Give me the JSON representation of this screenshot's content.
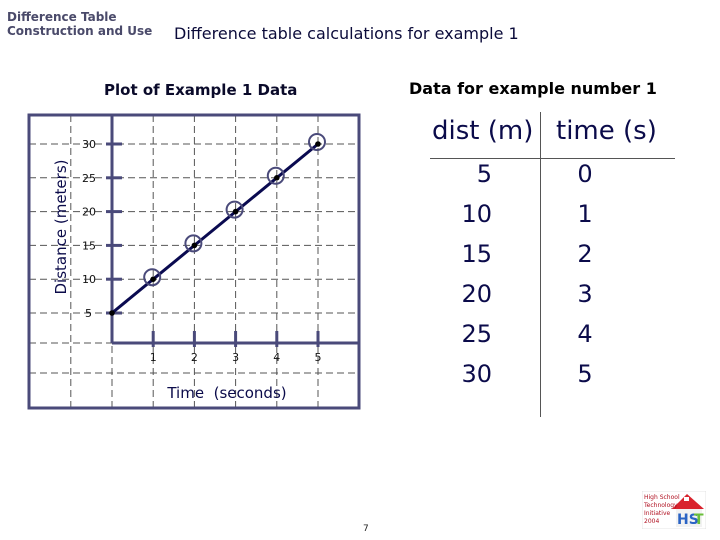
{
  "course_title": [
    "Difference Table",
    "Construction and Use"
  ],
  "slide_title": "Difference table calculations for example 1",
  "plot_title": "Plot of Example 1 Data",
  "table": {
    "title": "Data for example number 1",
    "headers": [
      "dist (m)",
      "time (s)"
    ],
    "rows": [
      [
        "5",
        "0"
      ],
      [
        "10",
        "1"
      ],
      [
        "15",
        "2"
      ],
      [
        "20",
        "3"
      ],
      [
        "25",
        "4"
      ],
      [
        "30",
        "5"
      ]
    ]
  },
  "chart_data": {
    "type": "line",
    "title": "Plot of Example 1 Data",
    "xlabel": "Time  (seconds)",
    "ylabel": "Distance (meters)",
    "x": [
      0,
      1,
      2,
      3,
      4,
      5
    ],
    "series": [
      {
        "name": "distance",
        "values": [
          5,
          10,
          15,
          20,
          25,
          30
        ]
      }
    ],
    "marked_points": [
      {
        "x": 1,
        "y": 10
      },
      {
        "x": 2,
        "y": 15
      },
      {
        "x": 3,
        "y": 20
      },
      {
        "x": 4,
        "y": 25
      },
      {
        "x": 5,
        "y": 30
      }
    ],
    "x_ticks": [
      "1",
      "2",
      "3",
      "4",
      "5"
    ],
    "y_ticks": [
      "5",
      "10",
      "15",
      "20",
      "25",
      "30"
    ],
    "xlim": [
      -2,
      6
    ],
    "ylim": [
      0,
      35
    ],
    "grid": true,
    "colors": {
      "line": "#0a0a50",
      "frame": "#4a4a7a",
      "marker": "#4a4a7a"
    }
  },
  "page_number": "7",
  "logo": {
    "text_lines": [
      "High School",
      "Technology",
      "Initiative",
      "2004"
    ],
    "letters": "HSTi"
  }
}
